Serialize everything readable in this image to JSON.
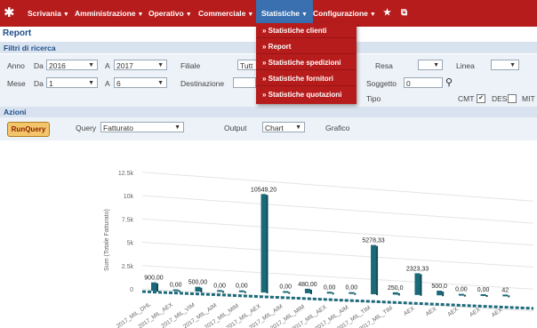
{
  "nav": {
    "items": [
      "Scrivania",
      "Amministrazione",
      "Operativo",
      "Commerciale",
      "Statistiche",
      "Configurazione"
    ]
  },
  "page": {
    "title": "Report"
  },
  "filters": {
    "title": "Filtri di ricerca",
    "anno_label": "Anno",
    "da_label": "Da",
    "anno_da": "2016",
    "a_label": "A",
    "anno_a": "2017",
    "filiale_label": "Filiale",
    "filiale_value": "Tutt",
    "mese_label": "Mese",
    "mese_da": "1",
    "mese_a": "6",
    "destinazione_label": "Destinazione",
    "resa_label": "Resa",
    "linea_label": "Linea",
    "soggetto_label": "Soggetto",
    "soggetto_value": "0",
    "tipo_label": "Tipo",
    "cmt_label": "CMT",
    "des_label": "DES",
    "mit_label": "MIT"
  },
  "actions": {
    "title": "Azioni",
    "run_label": "RunQuery",
    "query_label": "Query",
    "query_value": "Fatturato",
    "output_label": "Output",
    "output_value": "Chart",
    "grafico_label": "Grafico"
  },
  "dropdown": {
    "items": [
      "» Statistiche clienti",
      "» Report",
      "» Statistiche spedizioni",
      "» Statistiche fornitori",
      "» Statistiche quotazioni"
    ]
  },
  "chart_data": {
    "type": "bar",
    "ylabel": "Sum (Totale Fatturato)",
    "yticks": [
      "0",
      "2.5k",
      "5k",
      "7.5k",
      "10k",
      "12.5k"
    ],
    "ylim": [
      0,
      12500
    ],
    "categories": [
      "2017_MIL_DHL",
      "2017_MIL_AEX",
      "2017_MIL_VIM",
      "2017_MIL_AIM",
      "2017_MIL_MIM",
      "2017_MIL_AEX",
      "2017_MIL_AIM",
      "2017_MIL_MIM",
      "2017_MIL_AEX",
      "2017_MIL_AIM",
      "2017_MIL_TIM",
      "2017_MIL_TIM",
      "AEX",
      "AEX",
      "AEX",
      "AEX",
      "AEX"
    ],
    "values": [
      900.0,
      0.0,
      500.0,
      0.0,
      0.0,
      10549.2,
      0.0,
      480.0,
      0.0,
      0.0,
      5278.33,
      250.0,
      2323.33,
      500.0,
      0.0,
      0.0,
      42
    ],
    "data_labels": [
      "900,00",
      "0,00",
      "500,00",
      "0,00",
      "0,00",
      "10549,20",
      "0,00",
      "480,00",
      "0,00",
      "0,00",
      "5278,33",
      "250,0",
      "2323,33",
      "500,0",
      "0,00",
      "0,00",
      "42"
    ],
    "grid": true,
    "color": "#1a6a7a"
  }
}
